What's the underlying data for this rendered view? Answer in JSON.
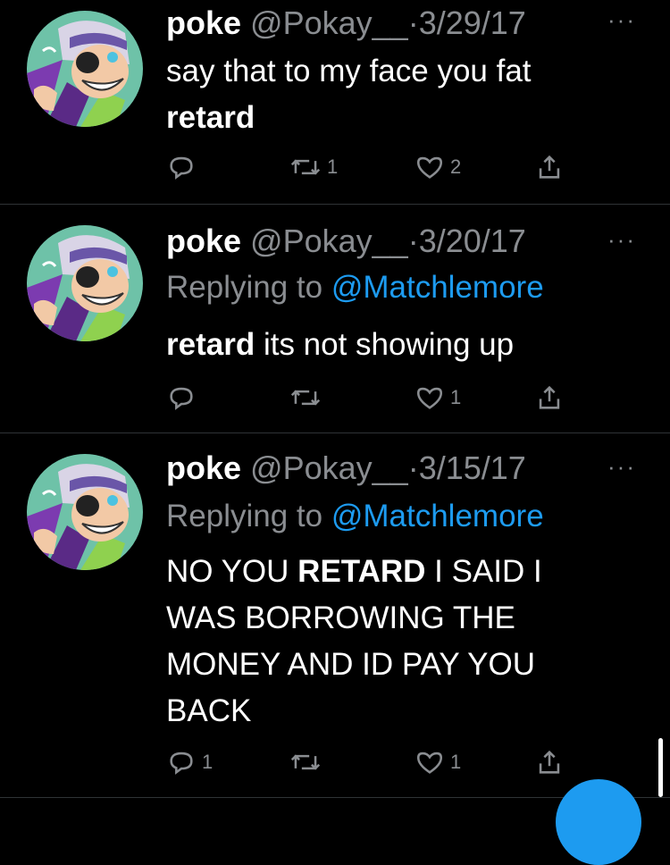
{
  "colors": {
    "background": "#000000",
    "text": "#ffffff",
    "secondary": "#8a8d91",
    "mention": "#1d9bf0",
    "divider": "#2f3336"
  },
  "tweets": [
    {
      "name": "poke",
      "handle": "@Pokay__",
      "separator": "·",
      "date": "3/29/17",
      "more_icon": "ellipsis-icon",
      "replying_prefix": "",
      "replying_to": "",
      "body_line1": "say that to my face you fat",
      "body_bold": "retard",
      "body_rest": "",
      "reply_count": "",
      "retweet_count": "1",
      "like_count": "2"
    },
    {
      "name": "poke",
      "handle": "@Pokay__",
      "separator": "·",
      "date": "3/20/17",
      "more_icon": "ellipsis-icon",
      "replying_prefix": "Replying to",
      "replying_to": "@Matchlemore",
      "body_bold": "retard",
      "body_rest": " its not showing up",
      "reply_count": "",
      "retweet_count": "",
      "like_count": "1"
    },
    {
      "name": "poke",
      "handle": "@Pokay__",
      "separator": "·",
      "date": "3/15/17",
      "more_icon": "ellipsis-icon",
      "replying_prefix": "Replying to",
      "replying_to": "@Matchlemore",
      "body_pre": "NO YOU ",
      "body_bold": "RETARD",
      "body_rest": " I SAID I WAS BORROWING THE MONEY AND ID PAY YOU BACK",
      "reply_count": "1",
      "retweet_count": "",
      "like_count": "1"
    }
  ],
  "more_label": "···"
}
